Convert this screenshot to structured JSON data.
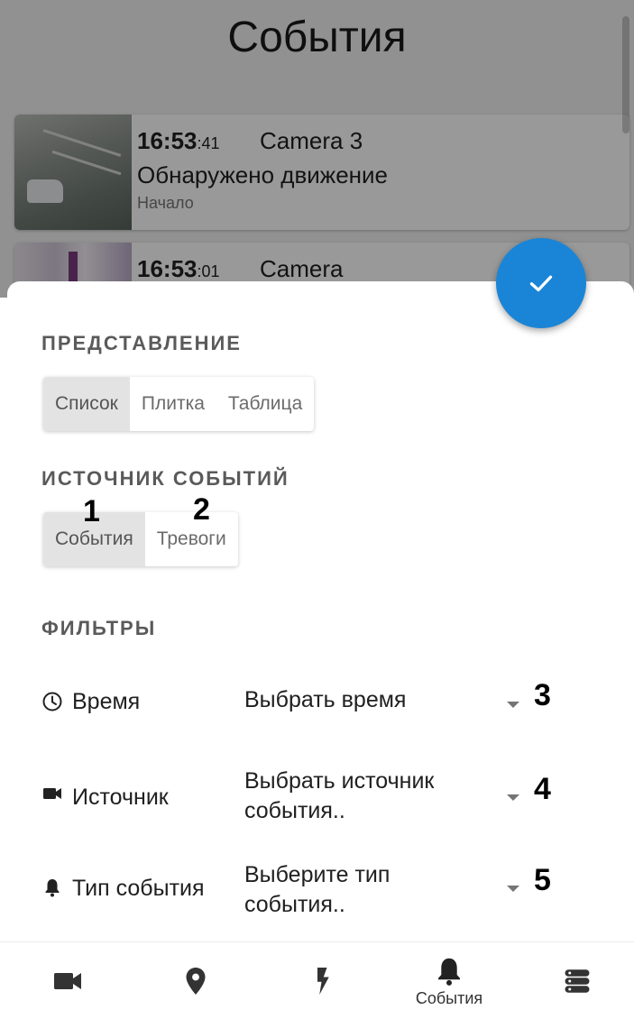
{
  "header": {
    "title": "События"
  },
  "events": [
    {
      "time_hm": "16:53",
      "time_s": ":41",
      "camera": "Camera 3",
      "description": "Обнаружено движение",
      "sub": "Начало"
    },
    {
      "time_hm": "16:53",
      "time_s": ":01",
      "camera": "Camera"
    }
  ],
  "sheet": {
    "view_title": "ПРЕДСТАВЛЕНИЕ",
    "view_options": [
      "Список",
      "Плитка",
      "Таблица"
    ],
    "view_selected": "Список",
    "source_title": "ИСТОЧНИК СОБЫТИЙ",
    "source_options": [
      "События",
      "Тревоги"
    ],
    "source_selected": "События",
    "filters_title": "ФИЛЬТРЫ",
    "filters": [
      {
        "label": "Время",
        "value": "Выбрать время",
        "icon": "clock-icon",
        "marker": "3"
      },
      {
        "label": "Источник",
        "value": "Выбрать источник события..",
        "icon": "videocam-icon",
        "marker": "4"
      },
      {
        "label": "Тип события",
        "value": "Выберите тип события..",
        "icon": "bell-icon",
        "marker": "5"
      }
    ]
  },
  "markers": {
    "m1": "1",
    "m2": "2"
  },
  "bottom_nav": {
    "items": [
      {
        "icon": "videocam-icon"
      },
      {
        "icon": "location-pin-icon"
      },
      {
        "icon": "lightning-icon"
      },
      {
        "icon": "bell-icon",
        "label": "События",
        "active": true
      },
      {
        "icon": "servers-icon"
      }
    ]
  },
  "colors": {
    "accent": "#1a85d6",
    "segment_active": "#e3e3e3"
  }
}
